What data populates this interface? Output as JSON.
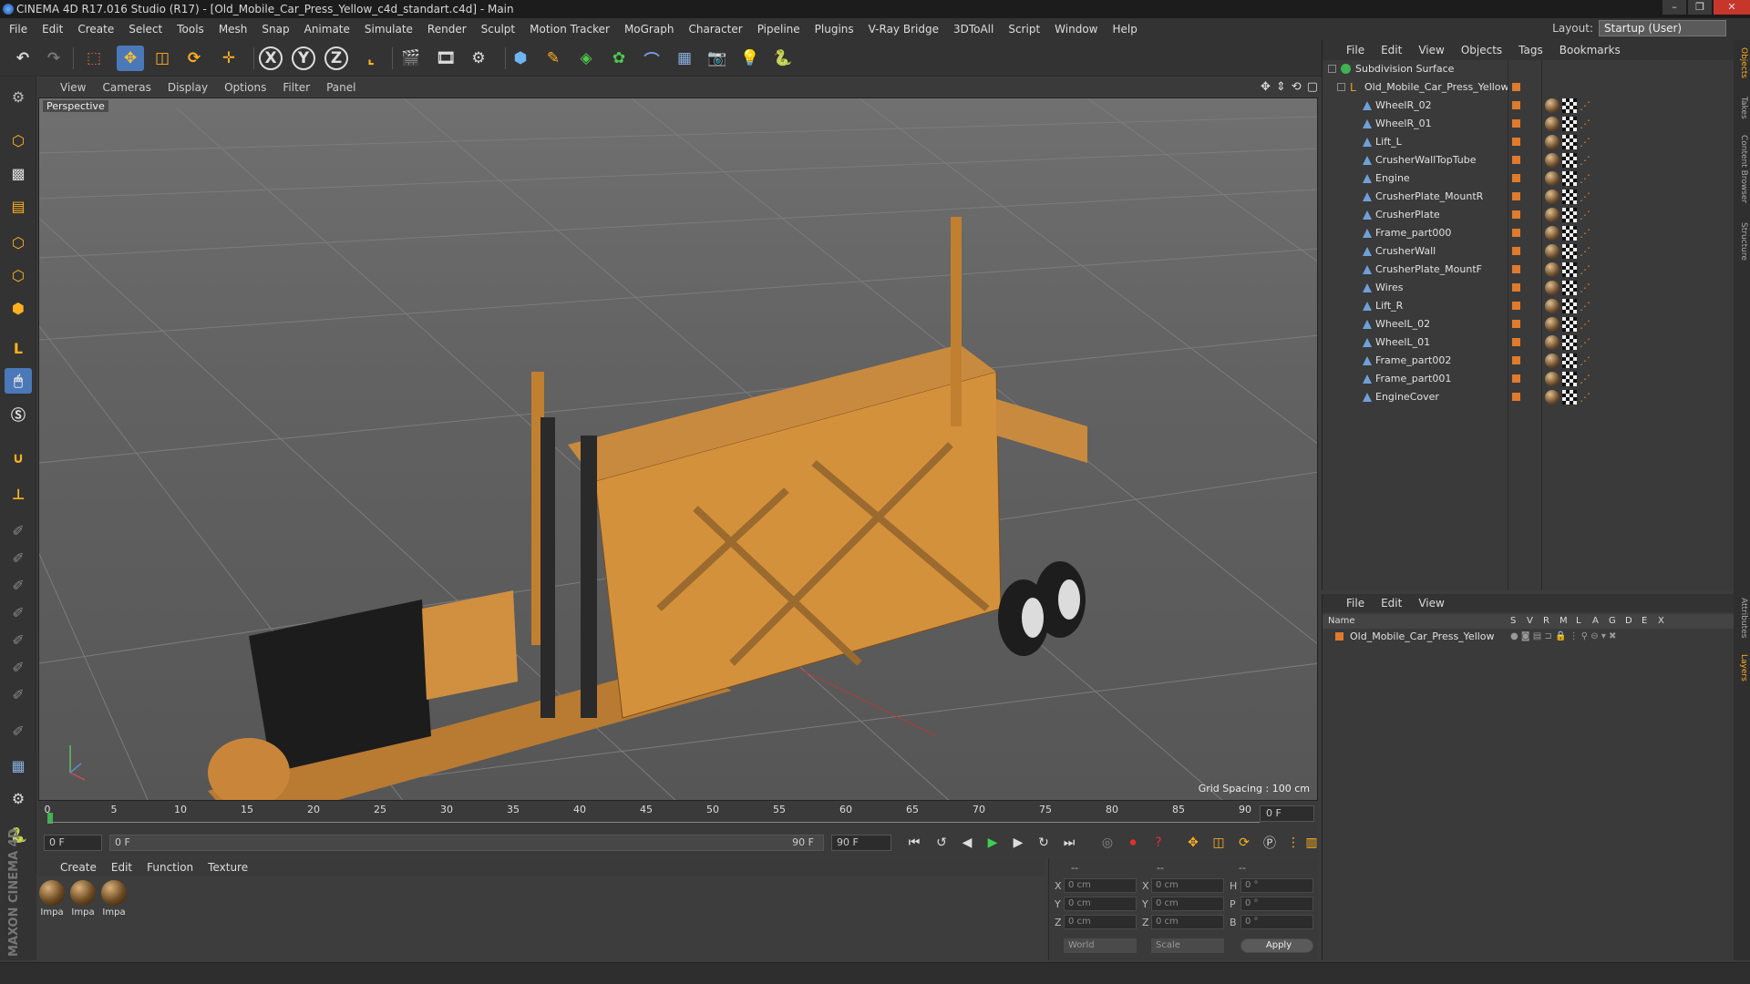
{
  "window": {
    "title": "CINEMA 4D R17.016 Studio (R17) - [Old_Mobile_Car_Press_Yellow_c4d_standart.c4d] - Main"
  },
  "menubar": {
    "items": [
      "File",
      "Edit",
      "Create",
      "Select",
      "Tools",
      "Mesh",
      "Snap",
      "Animate",
      "Simulate",
      "Render",
      "Sculpt",
      "Motion Tracker",
      "MoGraph",
      "Character",
      "Pipeline",
      "Plugins",
      "V-Ray Bridge",
      "3DToAll",
      "Script",
      "Window",
      "Help"
    ],
    "layout_label": "Layout:",
    "layout_value": "Startup (User)"
  },
  "viewport": {
    "menu": [
      "View",
      "Cameras",
      "Display",
      "Options",
      "Filter",
      "Panel"
    ],
    "camera_label": "Perspective",
    "grid_spacing": "Grid Spacing : 100 cm"
  },
  "timeline": {
    "ticks": [
      "0",
      "5",
      "10",
      "15",
      "20",
      "25",
      "30",
      "35",
      "40",
      "45",
      "50",
      "55",
      "60",
      "65",
      "70",
      "75",
      "80",
      "85",
      "90"
    ],
    "current_frame": "0 F"
  },
  "transport": {
    "start_field": "0 F",
    "range_start": "0 F",
    "range_end": "90 F",
    "end_field": "90 F"
  },
  "material_manager": {
    "menu": [
      "Create",
      "Edit",
      "Function",
      "Texture"
    ],
    "materials": [
      "Impa",
      "Impa",
      "Impa"
    ]
  },
  "coordinates": {
    "headers": [
      "--",
      "--",
      "--"
    ],
    "rows": [
      {
        "a_label": "X",
        "a_val": "0 cm",
        "b_label": "X",
        "b_val": "0 cm",
        "c_label": "H",
        "c_val": "0 °"
      },
      {
        "a_label": "Y",
        "a_val": "0 cm",
        "b_label": "Y",
        "b_val": "0 cm",
        "c_label": "P",
        "c_val": "0 °"
      },
      {
        "a_label": "Z",
        "a_val": "0 cm",
        "b_label": "Z",
        "b_val": "0 cm",
        "c_label": "B",
        "c_val": "0 °"
      }
    ],
    "mode": "World",
    "scale": "Scale",
    "apply": "Apply"
  },
  "object_manager": {
    "menu": [
      "File",
      "Edit",
      "View",
      "Objects",
      "Tags",
      "Bookmarks"
    ],
    "root": "Subdivision Surface",
    "group": "Old_Mobile_Car_Press_Yellow",
    "objects": [
      "WheelR_02",
      "WheelR_01",
      "Lift_L",
      "CrusherWallTopTube",
      "Engine",
      "CrusherPlate_MountR",
      "CrusherPlate",
      "Frame_part000",
      "CrusherWall",
      "CrusherPlate_MountF",
      "Wires",
      "Lift_R",
      "WheelL_02",
      "WheelL_01",
      "Frame_part002",
      "Frame_part001",
      "EngineCover"
    ]
  },
  "layer_manager": {
    "menu": [
      "File",
      "Edit",
      "View"
    ],
    "columns": [
      "Name",
      "S",
      "V",
      "R",
      "M",
      "L",
      "A",
      "G",
      "D",
      "E",
      "X"
    ],
    "layer": "Old_Mobile_Car_Press_Yellow"
  },
  "right_tabs": [
    "Objects",
    "Takes",
    "Content Browser",
    "Structure",
    "Attributes",
    "Layers"
  ],
  "maxon_logo": "MAXON CINEMA 4D",
  "colors": {
    "accent_orange": "#e07a2c",
    "model_yellow": "#d4913c",
    "select_blue": "#4a78b8"
  }
}
